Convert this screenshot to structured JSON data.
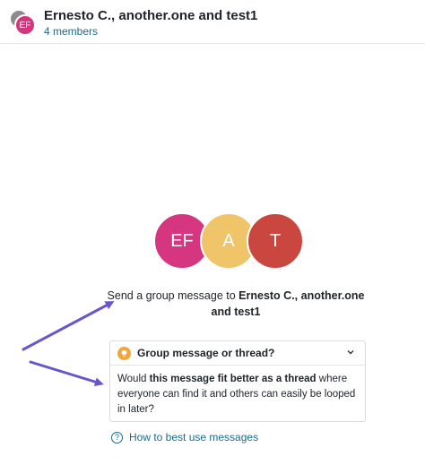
{
  "header": {
    "avatar_initials": "EF",
    "title": "Ernesto C., another.one and test1",
    "members": "4 members"
  },
  "members_avatars": [
    {
      "initials": "EF",
      "color": "#d6367f"
    },
    {
      "initials": "A",
      "color": "#f0c56a"
    },
    {
      "initials": "T",
      "color": "#c9473e"
    }
  ],
  "intro": {
    "prefix": "Send a group message to ",
    "names": "Ernesto C., another.one and test1"
  },
  "tip_card": {
    "icon": "lightbulb-icon",
    "title": "Group message or thread?",
    "body_prefix": "Would ",
    "body_bold": "this message fit better as a thread",
    "body_suffix": " where everyone can find it and others can easily be looped in later?"
  },
  "help_link": {
    "label": "How to best use messages",
    "icon": "question-circle-icon"
  },
  "colors": {
    "link": "#1f6b8a",
    "annotation_arrow": "#6b56c9"
  }
}
